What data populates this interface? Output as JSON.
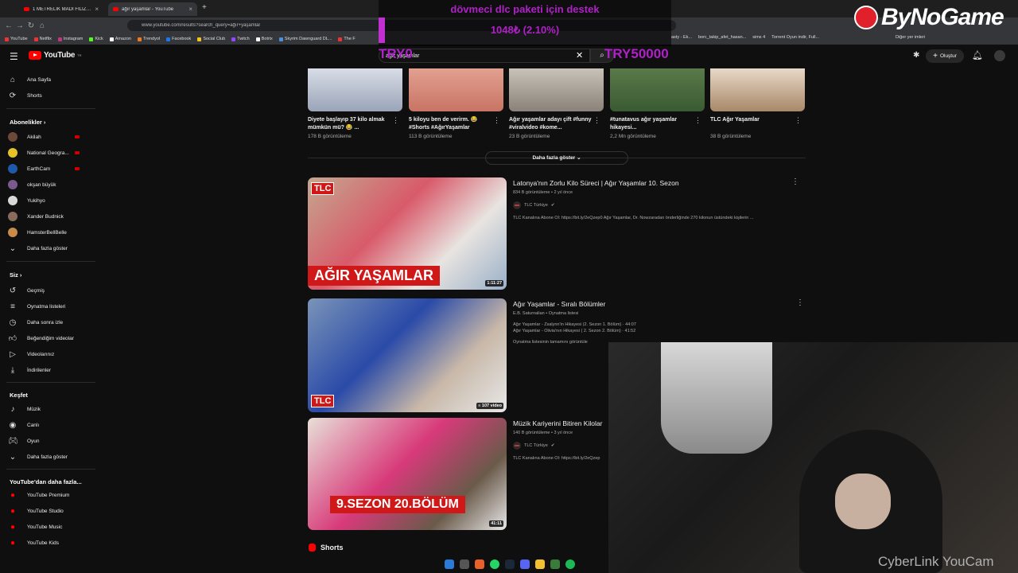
{
  "browser": {
    "tabs": [
      {
        "label": "1 METRELİK MADİ FİLİZ - YouTu"
      },
      {
        "label": "ağır yaşamlar - YouTube"
      }
    ],
    "url": "www.youtube.com/results?search_query=ağır+yaşamlar",
    "bookmarks": [
      "YouTube",
      "Netflix",
      "Instagram",
      "Kick",
      "Amazon",
      "Trendyol",
      "Facebook",
      "Social Club",
      "Twitch",
      "Botrix",
      "Skyrim Dawnguard DL...",
      "The F"
    ],
    "bookmarks_right": [
      "asty - Ek...",
      "borc_takip_afet_hasan...",
      "sims 4",
      "Torrent Oyun indir, Full...",
      "Diğer yer imleri"
    ]
  },
  "overlay": {
    "donation_title": "dövmeci dlc paketi için destek",
    "donation_amount": "1048₺ (2.10%)",
    "try_left": "TRY0",
    "try_right": "TRY50000",
    "brand": "ByNoGame",
    "cam_brand": "CyberLink YouCam"
  },
  "header": {
    "logo": "YouTube",
    "logo_sup": "TR",
    "search_value": "ağır yaşamlar",
    "create_label": "Oluştur"
  },
  "sidebar": {
    "main": [
      {
        "label": "Ana Sayfa"
      },
      {
        "label": "Shorts"
      }
    ],
    "subs_title": "Abonelikler",
    "subs": [
      {
        "label": "Akilah",
        "color": "#6b4a3a"
      },
      {
        "label": "National Geogra...",
        "color": "#e6c229"
      },
      {
        "label": "EarthCam",
        "color": "#1e5aa8"
      },
      {
        "label": "okşan büyük",
        "color": "#7a5a8a"
      },
      {
        "label": "Yukihyo",
        "color": "#d8d8d8"
      },
      {
        "label": "Xander Budnick",
        "color": "#8a6a5a"
      },
      {
        "label": "HamsterBellBelle",
        "color": "#c98a4a"
      }
    ],
    "subs_more": "Daha fazla göster",
    "you_title": "Siz",
    "you": [
      {
        "label": "Geçmiş"
      },
      {
        "label": "Oynatma listeleri"
      },
      {
        "label": "Daha sonra izle"
      },
      {
        "label": "Beğendiğim videolar"
      },
      {
        "label": "Videolarınız"
      },
      {
        "label": "İndirilenler"
      }
    ],
    "explore_title": "Keşfet",
    "explore": [
      {
        "label": "Müzik"
      },
      {
        "label": "Canlı"
      },
      {
        "label": "Oyun"
      },
      {
        "label": "Daha fazla göster"
      }
    ],
    "more_title": "YouTube'dan daha fazla...",
    "more": [
      {
        "label": "YouTube Premium"
      },
      {
        "label": "YouTube Studio"
      },
      {
        "label": "YouTube Music"
      },
      {
        "label": "YouTube Kids"
      }
    ]
  },
  "shorts": [
    {
      "title": "Diyete başlayıp 37 kilo almak mümkün mü? 😂 ...",
      "views": "178 B görüntüleme"
    },
    {
      "title": "5 kiloyu ben de verirm. 😂 #Shorts #AğırYaşamlar",
      "views": "113 B görüntüleme"
    },
    {
      "title": "Ağır yaşamlar adayı çift #funny #viralvideo #kome...",
      "views": "23 B görüntüleme"
    },
    {
      "title": "#tunatavus ağır yaşamlar hikayesi...",
      "views": "2,2 Mn görüntüleme"
    },
    {
      "title": "TLC Ağır Yaşamlar",
      "views": "38 B görüntüleme"
    }
  ],
  "show_more": "Daha fazla göster",
  "videos": [
    {
      "title": "Latonya'nın Zorlu Kilo Süreci | Ağır Yaşamlar 10. Sezon",
      "meta": "834 B görüntüleme • 2 yıl önce",
      "channel": "TLC Türkiye",
      "desc": "TLC Kanalına Abone Ol: https://bit.ly/2eQzep0 Ağır Yaşamlar, Dr. Nowzaradan önderliğinde 270 kilonun üstündeki kişilerin ...",
      "duration": "1:11:27",
      "badge": "TLC",
      "caption": "AĞIR YAŞAMLAR"
    },
    {
      "title": "Ağır Yaşamlar - Sıralı Bölümler",
      "meta": "E.B. Saturnalian • Oynatma listesi",
      "line1": "Ağır Yaşamlar - Zsalynn'in Hikayesi (2. Sezon 1. Bölüm) · 44:07",
      "line2": "Ağır Yaşamlar - Olivia'nın Hikayesi ( 2. Sezon 2. Bölüm) · 41:52",
      "desc": "Oynatma listesinin tamamını görüntüle",
      "duration": "107 video",
      "badge": "TLC"
    },
    {
      "title": "Müzik Kariyerini Bitiren Kilolar",
      "meta": "140 B görüntüleme • 3 yıl önce",
      "channel": "TLC Türkiye",
      "desc": "TLC Kanalına Abone Ol: https://bit.ly/2eQzep",
      "duration": "41:11",
      "caption": "9.SEZON 20.BÖLÜM"
    }
  ],
  "shorts_section": "Shorts"
}
